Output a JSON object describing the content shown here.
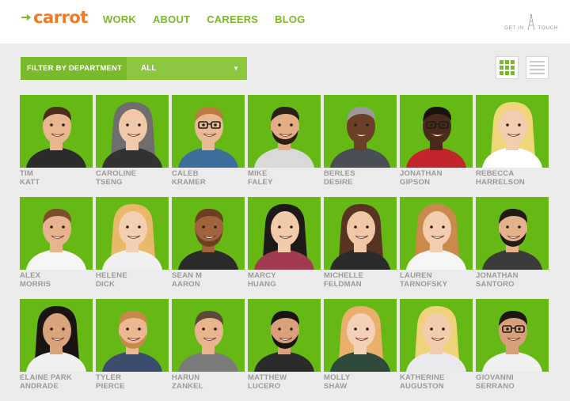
{
  "header": {
    "logo_text": "carrot",
    "nav": [
      "WORK",
      "ABOUT",
      "CAREERS",
      "BLOG"
    ],
    "contact_left": "GET IN",
    "contact_right": "TOUCH"
  },
  "filter": {
    "label": "FILTER BY DEPARTMENT",
    "value": "ALL"
  },
  "colors": {
    "brand_green": "#7ab929",
    "tile_green": "#66b914",
    "logo_orange": "#f47920"
  },
  "people": [
    {
      "first": "TIM",
      "last": "KATT",
      "skin": "#e8b68f",
      "hair": "#4a2e1a",
      "shirt": "#2b2b2b"
    },
    {
      "first": "CAROLINE",
      "last": "TSENG",
      "skin": "#f1c9a8",
      "hair": "#6e6e6e",
      "shirt": "#333333"
    },
    {
      "first": "CALEB",
      "last": "KRAMER",
      "skin": "#e9b994",
      "hair": "#b97b3e",
      "shirt": "#3d6d9a"
    },
    {
      "first": "MIKE",
      "last": "FALEY",
      "skin": "#e3ad86",
      "hair": "#2a2018",
      "shirt": "#d9d9d9"
    },
    {
      "first": "BERLES",
      "last": "DESIRE",
      "skin": "#6b4028",
      "hair": "#9a9a9a",
      "shirt": "#4a4f55"
    },
    {
      "first": "JONATHAN",
      "last": "GIPSON",
      "skin": "#4a2b1a",
      "hair": "#1a1210",
      "shirt": "#c2262b"
    },
    {
      "first": "REBECCA",
      "last": "HARRELSON",
      "skin": "#f3cdb0",
      "hair": "#f0d67a",
      "shirt": "#ffffff"
    },
    {
      "first": "ALEX",
      "last": "MORRIS",
      "skin": "#e6b48e",
      "hair": "#7a4e2a",
      "shirt": "#f5f5f5"
    },
    {
      "first": "HELENE",
      "last": "DICK",
      "skin": "#f3cfb3",
      "hair": "#e8b96a",
      "shirt": "#f0f0f0"
    },
    {
      "first": "SEAN M",
      "last": "AARON",
      "skin": "#a0643c",
      "hair": "#6b3f22",
      "shirt": "#2b2b2b"
    },
    {
      "first": "MARCY",
      "last": "HUANG",
      "skin": "#f1cba9",
      "hair": "#1e1a18",
      "shirt": "#a23b4f"
    },
    {
      "first": "MICHELLE",
      "last": "FELDMAN",
      "skin": "#f0c8a6",
      "hair": "#5a3422",
      "shirt": "#2b2b2b"
    },
    {
      "first": "LAUREN",
      "last": "TARNOFSKY",
      "skin": "#f3cdb0",
      "hair": "#c98a4c",
      "shirt": "#f5f5f5"
    },
    {
      "first": "JONATHAN",
      "last": "SANTORO",
      "skin": "#e4b28c",
      "hair": "#241a14",
      "shirt": "#3a3a3a"
    },
    {
      "first": "ELAINE PARK",
      "last": "ANDRADE",
      "skin": "#d9a37c",
      "hair": "#1a1412",
      "shirt": "#f0f0f0"
    },
    {
      "first": "TYLER",
      "last": "PIERCE",
      "skin": "#ebb892",
      "hair": "#c88a4a",
      "shirt": "#3c4c6c"
    },
    {
      "first": "HARUN",
      "last": "ZANKEL",
      "skin": "#e8b58f",
      "hair": "#5a4a3a",
      "shirt": "#7a7a7a"
    },
    {
      "first": "MATTHEW",
      "last": "LUCERO",
      "skin": "#d9a17a",
      "hair": "#1a1412",
      "shirt": "#2b2b2b"
    },
    {
      "first": "MOLLY",
      "last": "SHAW",
      "skin": "#f4d1b6",
      "hair": "#e9b06c",
      "shirt": "#2f4a3a"
    },
    {
      "first": "KATHERINE",
      "last": "AUGUSTON",
      "skin": "#f2ccad",
      "hair": "#f0d27a",
      "shirt": "#e9e9ee"
    },
    {
      "first": "GIOVANNI",
      "last": "SERRANO",
      "skin": "#d6a07a",
      "hair": "#1e1612",
      "shirt": "#f0f0f0"
    }
  ]
}
